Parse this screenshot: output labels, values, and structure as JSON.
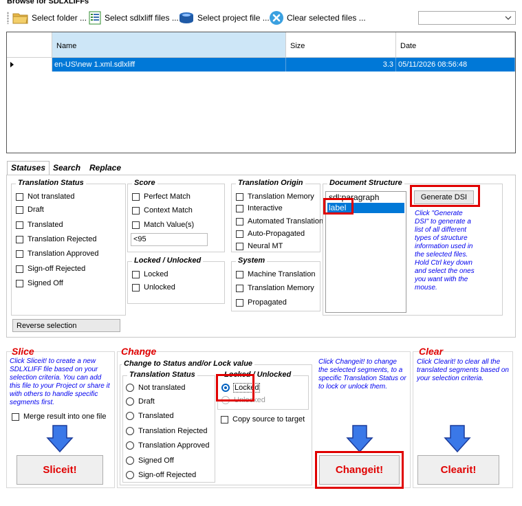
{
  "window": {
    "title": "Browse for SDLXLIFFs"
  },
  "toolbar": {
    "select_folder": "Select folder ...",
    "select_files": "Select sdlxliff files ...",
    "select_project": "Select project file ...",
    "clear_files": "Clear selected files ..."
  },
  "grid": {
    "columns": {
      "name": "Name",
      "size": "Size",
      "date": "Date"
    },
    "rows": [
      {
        "name": "en-US\\new 1.xml.sdlxliff",
        "size": "3.3",
        "date": "05/11/2026 08:56:48"
      }
    ]
  },
  "tabs": [
    "Statuses",
    "Search",
    "Replace"
  ],
  "statuses": {
    "translation_status": {
      "title": "Translation Status",
      "items": [
        "Not translated",
        "Draft",
        "Translated",
        "Translation Rejected",
        "Translation Approved",
        "Sign-off Rejected",
        "Signed Off"
      ]
    },
    "score": {
      "title": "Score",
      "items": [
        "Perfect Match",
        "Context Match",
        "Match Value(s)"
      ],
      "match_value": "<95"
    },
    "locked": {
      "title": "Locked / Unlocked",
      "items": [
        "Locked",
        "Unlocked"
      ]
    },
    "translation_origin": {
      "title": "Translation Origin",
      "items": [
        "Translation Memory",
        "Interactive",
        "Automated Translation",
        "Auto-Propagated",
        "Neural MT"
      ]
    },
    "system": {
      "title": "System",
      "items": [
        "Machine Translation",
        "Translation Memory",
        "Propagated"
      ]
    },
    "document_structure": {
      "title": "Document Structure",
      "items": [
        "sdl:paragraph",
        "label"
      ],
      "selected": "label",
      "generate_label": "Generate DSI",
      "hint": "Click \"Generate DSI\" to generate a list of all different types of structure information used in the selected files. Hold Ctrl key down and select the ones you want with the mouse."
    },
    "reverse_label": "Reverse selection"
  },
  "slice": {
    "title": "Slice",
    "hint": "Click Sliceit! to create a new SDLXLIFF file based on your selection criteria. You can add this file to your Project or share it with others to handle specific segments first.",
    "merge_label": "Merge result into one file",
    "button": "Sliceit!"
  },
  "change": {
    "title": "Change",
    "group_title": "Change to Status and/or Lock value",
    "status_title": "Translation Status",
    "statuses": [
      "Not translated",
      "Draft",
      "Translated",
      "Translation Rejected",
      "Translation Approved",
      "Signed Off",
      "Sign-off Rejected"
    ],
    "lock_title": "Locked / Unlocked",
    "lock_items": [
      "Locked",
      "Unlocked"
    ],
    "lock_selected": "Locked",
    "copy_source": "Copy source to target",
    "hint": "Click Changeit! to change the selected segments, to a specific Translation Status or to lock or unlock them.",
    "button": "Changeit!"
  },
  "clear": {
    "title": "Clear",
    "hint": "Click Clearit! to clear all the translated segments based on your selection criteria.",
    "button": "Clearit!"
  },
  "colors": {
    "accent": "#0078d7",
    "highlight": "#e00000",
    "hint": "#0000ee"
  }
}
